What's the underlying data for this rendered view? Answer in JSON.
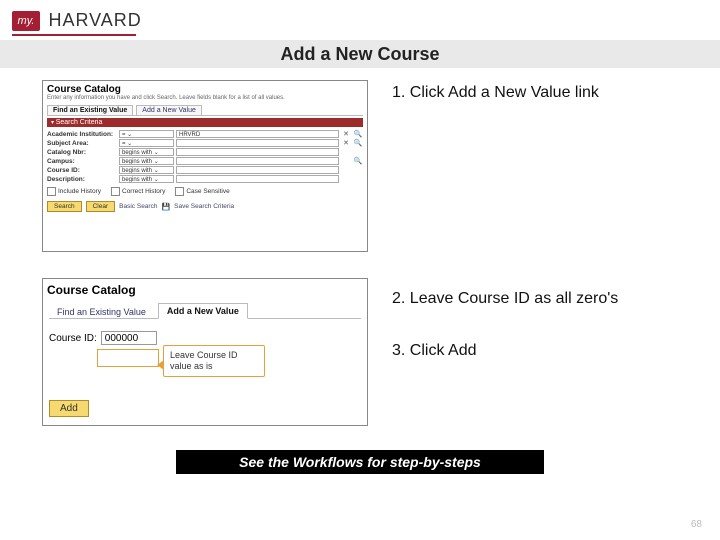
{
  "logo": {
    "badge": "my.",
    "brand": "HARVARD"
  },
  "title": "Add a New Course",
  "steps": {
    "s1": "1. Click Add a New Value link",
    "s2": "2. Leave Course ID as all zero's",
    "s3": "3. Click Add"
  },
  "panel1": {
    "heading": "Course Catalog",
    "subtext": "Enter any information you have and click Search. Leave fields blank for a list of all values.",
    "tabs": {
      "find": "Find an Existing Value",
      "add": "Add a New Value"
    },
    "search_criteria_label": "Search Criteria",
    "fields": [
      {
        "label": "Academic Institution:",
        "op": "=",
        "val": "HRVRD"
      },
      {
        "label": "Subject Area:",
        "op": "=",
        "val": ""
      },
      {
        "label": "Catalog Nbr:",
        "op": "begins with",
        "val": ""
      },
      {
        "label": "Campus:",
        "op": "begins with",
        "val": ""
      },
      {
        "label": "Course ID:",
        "op": "begins with",
        "val": ""
      },
      {
        "label": "Description:",
        "op": "begins with",
        "val": ""
      }
    ],
    "checks": {
      "include": "Include History",
      "correct": "Correct History",
      "case": "Case Sensitive"
    },
    "buttons": {
      "search": "Search",
      "clear": "Clear",
      "basic": "Basic Search",
      "save": "Save Search Criteria"
    }
  },
  "panel2": {
    "heading": "Course Catalog",
    "tabs": {
      "find": "Find an Existing Value",
      "add": "Add a New Value"
    },
    "course_id_label": "Course ID:",
    "course_id_value": "000000",
    "callout": "Leave Course ID value as is",
    "add_button": "Add"
  },
  "footer": "See the Workflows for step-by-steps",
  "page": "68"
}
